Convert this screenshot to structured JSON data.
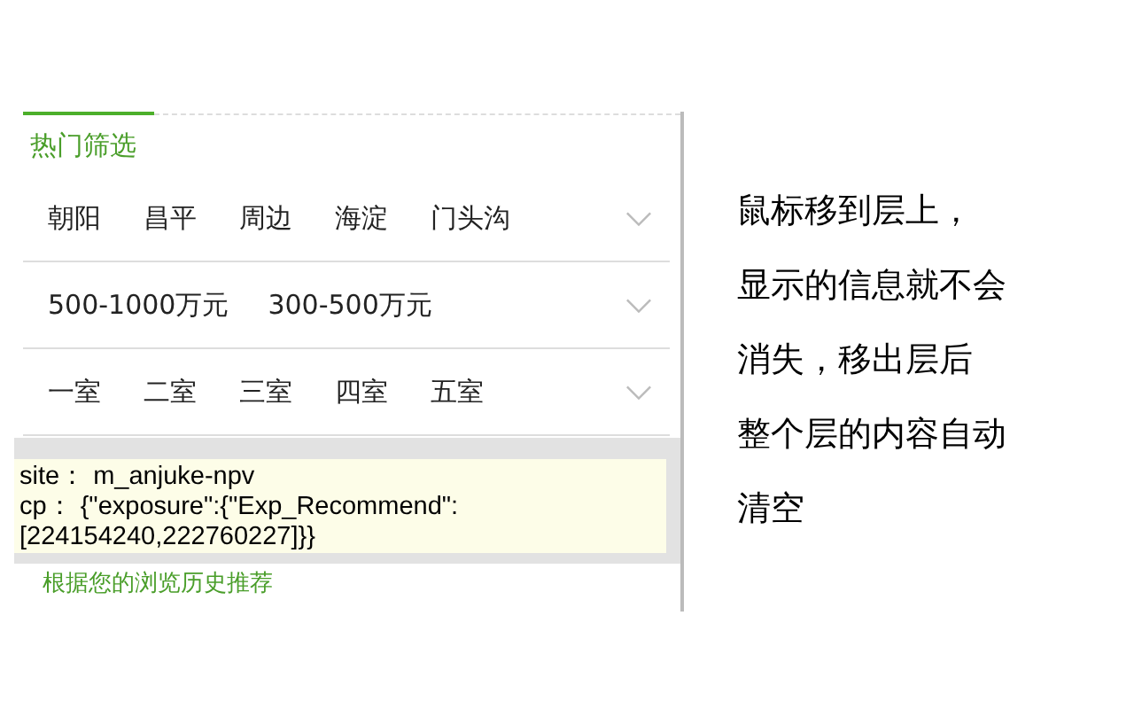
{
  "section_title": "热门筛选",
  "filter_rows": [
    {
      "options": [
        "朝阳",
        "昌平",
        "周边",
        "海淀",
        "门头沟"
      ]
    },
    {
      "options": [
        "500-1000万元",
        "300-500万元"
      ]
    },
    {
      "options": [
        "一室",
        "二室",
        "三室",
        "四室",
        "五室"
      ]
    }
  ],
  "tooltip": {
    "lines": [
      "site：  m_anjuke-npv",
      "cp：  {\"exposure\":{\"Exp_Recommend\":",
      "[224154240,222760227]}}"
    ]
  },
  "recommend_heading": "根据您的浏览历史推荐",
  "annotation": [
    "鼠标移到层上，",
    "显示的信息就不会",
    "消失，移出层后",
    "整个层的内容自动",
    "清空"
  ]
}
